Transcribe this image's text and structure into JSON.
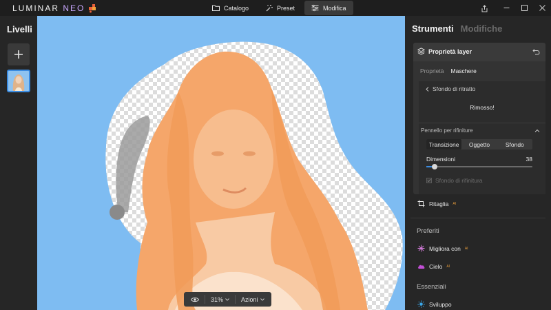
{
  "app": {
    "logo_main": "LUMINAR ",
    "logo_accent": "NEO",
    "brand_accent": "#c9a8ff"
  },
  "modes": [
    {
      "label": "Catalogo",
      "icon": "folder-icon",
      "active": false
    },
    {
      "label": "Preset",
      "icon": "magic-wand-icon",
      "active": false
    },
    {
      "label": "Modifica",
      "icon": "sliders-icon",
      "active": true
    }
  ],
  "left": {
    "title": "Livelli",
    "add_icon": "plus-icon"
  },
  "canvas_toolbar": {
    "zoom": "31%",
    "actions": "Azioni",
    "eye_icon": "eye-icon"
  },
  "right": {
    "tab_tools": "Strumenti",
    "tab_edits": "Modifiche",
    "layer_props": {
      "title": "Proprietà layer",
      "subtab_props": "Proprietà",
      "subtab_masks": "Maschere",
      "back_label": "Sfondo di ritratto",
      "status": "Rimosso!",
      "refine_title": "Pennello per rifiniture",
      "segments": [
        "Transizione",
        "Oggetto",
        "Sfondo"
      ],
      "active_segment": 0,
      "size_label": "Dimensioni",
      "size_value": "38",
      "size_fraction": 0.08,
      "checkbox_label": "Sfondo di rifinitura",
      "checkbox_checked": true
    },
    "crop_label": "Ritaglia",
    "ai_badge": "AI",
    "section_favorites": "Preferiti",
    "enhance_label": "Migliora con",
    "sky_label": "Cielo",
    "section_essentials": "Essenziali",
    "develop_label": "Sviluppo"
  },
  "colors": {
    "accent": "#3b8be0",
    "mask_orange": "#f6a86a",
    "background_blue": "#7ebcf2"
  }
}
